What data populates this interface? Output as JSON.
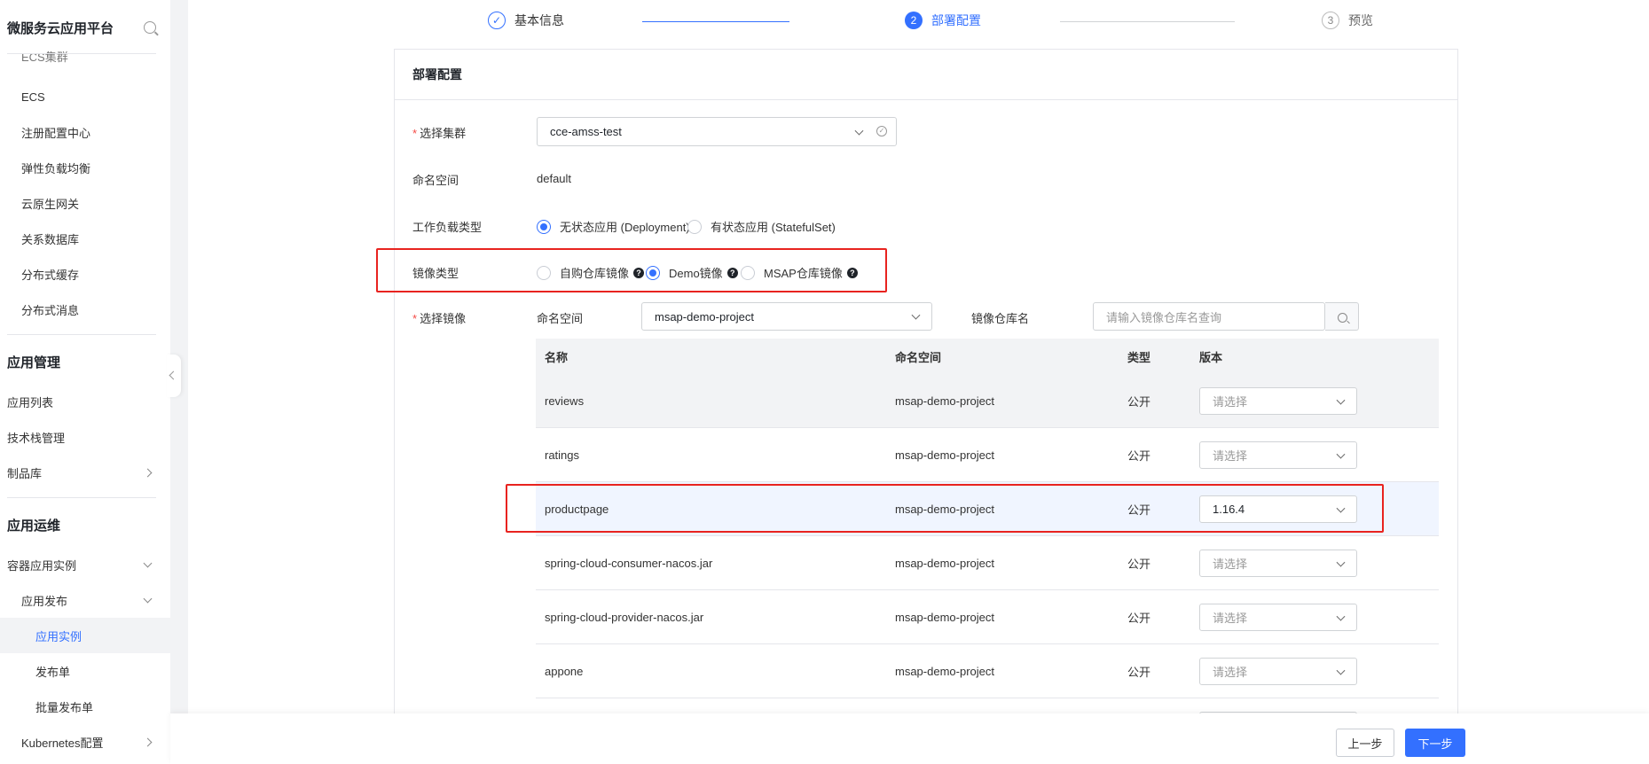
{
  "sidebar": {
    "title": "微服务云应用平台",
    "items": {
      "ecs_cluster": "ECS集群",
      "ecs": "ECS",
      "registry": "注册配置中心",
      "elb": "弹性负载均衡",
      "gateway": "云原生网关",
      "rdb": "关系数据库",
      "cache": "分布式缓存",
      "mq": "分布式消息"
    },
    "groups": {
      "app_mgmt": "应用管理",
      "app_ops": "应用运维"
    },
    "app_items": {
      "app_list": "应用列表",
      "stack": "技术栈管理",
      "artifact": "制品库"
    },
    "ops_items": {
      "container": "容器应用实例",
      "release": "应用发布",
      "instance": "应用实例",
      "release_order": "发布单",
      "batch_release": "批量发布单",
      "k8s": "Kubernetes配置"
    }
  },
  "steps": [
    {
      "index": "1",
      "label": "基本信息",
      "state": "done"
    },
    {
      "index": "2",
      "label": "部署配置",
      "state": "active"
    },
    {
      "index": "3",
      "label": "预览",
      "state": "todo"
    }
  ],
  "card": {
    "title": "部署配置",
    "cluster": {
      "label": "选择集群",
      "value": "cce-amss-test"
    },
    "namespace": {
      "label": "命名空间",
      "value": "default"
    },
    "workload": {
      "label": "工作负载类型",
      "options": [
        "无状态应用 (Deployment)",
        "有状态应用 (StatefulSet)"
      ],
      "selected": 0
    },
    "image_type": {
      "label": "镜像类型",
      "options": [
        "自购仓库镜像",
        "Demo镜像",
        "MSAP仓库镜像"
      ],
      "selected": 1
    },
    "image": {
      "label": "选择镜像",
      "ns_label": "命名空间",
      "ns_value": "msap-demo-project",
      "repo_label": "镜像仓库名",
      "repo_placeholder": "请输入镜像仓库名查询"
    },
    "table": {
      "headers": [
        "名称",
        "命名空间",
        "类型",
        "版本"
      ],
      "rows": [
        {
          "name": "reviews",
          "namespace": "msap-demo-project",
          "type": "公开",
          "version": "请选择",
          "placeholder": true
        },
        {
          "name": "ratings",
          "namespace": "msap-demo-project",
          "type": "公开",
          "version": "请选择",
          "placeholder": true
        },
        {
          "name": "productpage",
          "namespace": "msap-demo-project",
          "type": "公开",
          "version": "1.16.4",
          "placeholder": false
        },
        {
          "name": "spring-cloud-consumer-nacos.jar",
          "namespace": "msap-demo-project",
          "type": "公开",
          "version": "请选择",
          "placeholder": true
        },
        {
          "name": "spring-cloud-provider-nacos.jar",
          "namespace": "msap-demo-project",
          "type": "公开",
          "version": "请选择",
          "placeholder": true
        },
        {
          "name": "appone",
          "namespace": "msap-demo-project",
          "type": "公开",
          "version": "请选择",
          "placeholder": true
        }
      ]
    }
  },
  "footer": {
    "prev": "上一步",
    "next": "下一步"
  },
  "colors": {
    "primary": "#3370ff",
    "highlight": "#e8231f"
  },
  "icons": {
    "search": "search-icon",
    "check": "check-icon",
    "help": "help-icon"
  }
}
